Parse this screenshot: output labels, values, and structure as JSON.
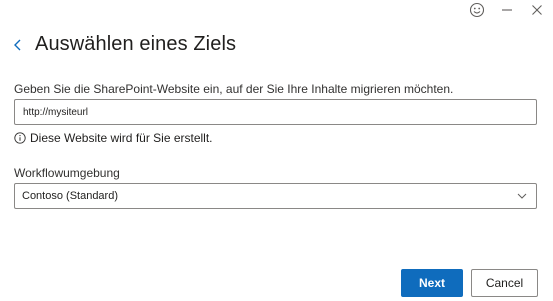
{
  "window": {
    "icons": [
      "smiley-feedback-icon",
      "minimize-icon",
      "close-icon"
    ]
  },
  "header": {
    "title": "Auswählen eines Ziels"
  },
  "site": {
    "label": "Geben Sie die SharePoint-Website ein, auf der Sie Ihre Inhalte migrieren möchten.",
    "value": "http://mysiteurl",
    "info": "Diese Website wird für Sie erstellt."
  },
  "workflow": {
    "label": "Workflowumgebung",
    "selected": "Contoso (Standard)"
  },
  "footer": {
    "next_label": "Next",
    "cancel_label": "Cancel"
  },
  "colors": {
    "primary": "#0f6cbd",
    "border": "#8a8886",
    "text": "#201f1e"
  }
}
